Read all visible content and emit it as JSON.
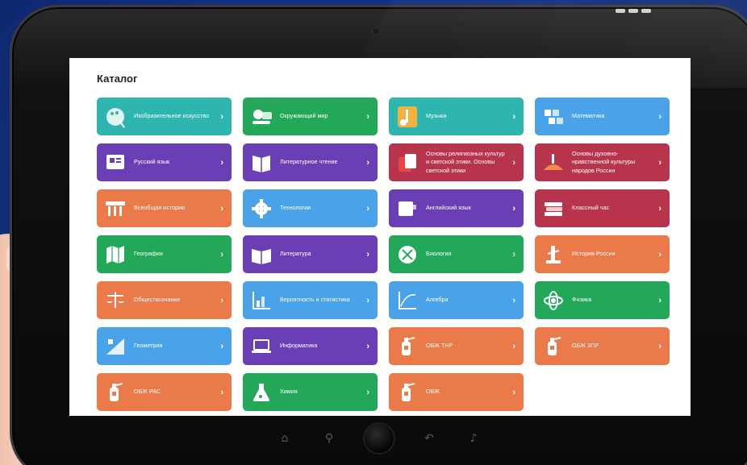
{
  "catalog": {
    "title": "Каталог",
    "items": [
      {
        "label": "Изобразительное искусство",
        "color": "#2fb5b0",
        "icon": "palette-icon"
      },
      {
        "label": "Окружающий мир",
        "color": "#23a85a",
        "icon": "globe-people-icon"
      },
      {
        "label": "Музыка",
        "color": "#2fb5b0",
        "icon": "music-note-icon"
      },
      {
        "label": "Математика",
        "color": "#4aa3e8",
        "icon": "numbers-icon"
      },
      {
        "label": "Русский язык",
        "color": "#6a3fb5",
        "icon": "book-letters-icon"
      },
      {
        "label": "Литературное чтение",
        "color": "#6a3fb5",
        "icon": "open-book-icon"
      },
      {
        "label": "Основы религиозных культур и светской этики. Основы светской этики",
        "color": "#b8344c",
        "icon": "religion-book-icon"
      },
      {
        "label": "Основы духовно-нравственной культуры народов России",
        "color": "#b8344c",
        "icon": "culture-icon"
      },
      {
        "label": "Всеобщая история",
        "color": "#ea7a4a",
        "icon": "column-icon"
      },
      {
        "label": "Технология",
        "color": "#4aa3e8",
        "icon": "gear-icon"
      },
      {
        "label": "Английский язык",
        "color": "#6a3fb5",
        "icon": "english-book-icon"
      },
      {
        "label": "Классный час",
        "color": "#b8344c",
        "icon": "books-stack-icon"
      },
      {
        "label": "География",
        "color": "#23a85a",
        "icon": "map-icon"
      },
      {
        "label": "Литература",
        "color": "#6a3fb5",
        "icon": "literature-book-icon"
      },
      {
        "label": "Биология",
        "color": "#23a85a",
        "icon": "dna-icon"
      },
      {
        "label": "История России",
        "color": "#ea7a4a",
        "icon": "monument-icon"
      },
      {
        "label": "Обществознание",
        "color": "#ea7a4a",
        "icon": "scales-icon"
      },
      {
        "label": "Вероятность и статистика",
        "color": "#4aa3e8",
        "icon": "statistics-chart-icon"
      },
      {
        "label": "Алгебра",
        "color": "#4aa3e8",
        "icon": "algebra-graph-icon"
      },
      {
        "label": "Физика",
        "color": "#23a85a",
        "icon": "atom-icon"
      },
      {
        "label": "Геометрия",
        "color": "#4aa3e8",
        "icon": "geometry-ruler-icon"
      },
      {
        "label": "Информатика",
        "color": "#6a3fb5",
        "icon": "laptop-icon"
      },
      {
        "label": "ОБЖ ТНР",
        "color": "#ea7a4a",
        "icon": "fire-extinguisher-icon"
      },
      {
        "label": "ОБЖ ЗПР",
        "color": "#ea7a4a",
        "icon": "fire-extinguisher-icon"
      },
      {
        "label": "ОБЖ РАС",
        "color": "#ea7a4a",
        "icon": "fire-extinguisher-icon"
      },
      {
        "label": "Химия",
        "color": "#23a85a",
        "icon": "flask-icon"
      },
      {
        "label": "ОБЖ",
        "color": "#ea7a4a",
        "icon": "fire-extinguisher-icon"
      }
    ]
  },
  "device": {
    "nav": [
      {
        "icon": "home-icon"
      },
      {
        "icon": "search-icon"
      },
      {
        "icon": "back-icon"
      },
      {
        "icon": "volume-icon"
      }
    ]
  }
}
